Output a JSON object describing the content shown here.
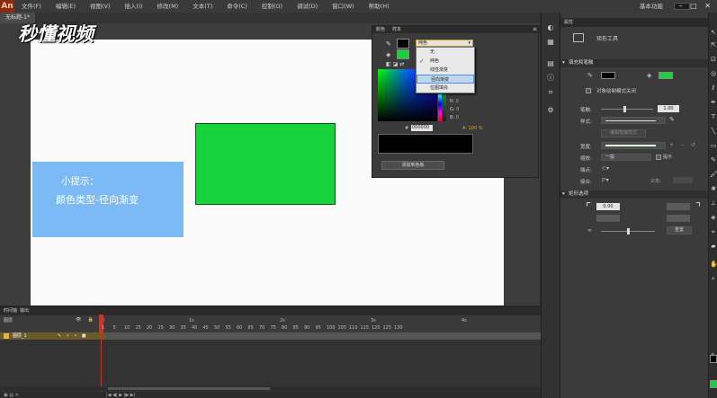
{
  "app": {
    "logo": "An",
    "menus": [
      "文件(F)",
      "编辑(E)",
      "视图(V)",
      "插入(I)",
      "修改(M)",
      "文本(T)",
      "命令(C)",
      "控制(O)",
      "调试(D)",
      "窗口(W)",
      "帮助(H)"
    ],
    "workspace": "基本功能",
    "window_controls": "– □ ✕"
  },
  "document": {
    "tab_title": "无标题-1*",
    "watermark": "秒懂视频"
  },
  "stage": {
    "tip_title": "小提示：",
    "tip_body": "颜色类型-径向渐变",
    "shape_color": "#17d33b",
    "stage_color": "#fbfbfc"
  },
  "color_panel": {
    "tabs": [
      "颜色",
      "样本"
    ],
    "menu_icon": "≡",
    "stroke_color": "#000000",
    "fill_color": "#17d33b",
    "type_select": "纯色",
    "type_options": [
      {
        "label": "无",
        "checked": false
      },
      {
        "label": "纯色",
        "checked": true
      },
      {
        "label": "线性渐变",
        "checked": false
      },
      {
        "label": "径向渐变",
        "checked": false,
        "highlighted": true
      },
      {
        "label": "位图填充",
        "checked": false
      }
    ],
    "hsb": [
      {
        "key": "H",
        "value": "1"
      },
      {
        "key": "S",
        "value": "0"
      },
      {
        "key": "B",
        "value": "0"
      },
      {
        "key": "R",
        "value": "0"
      },
      {
        "key": "G",
        "value": "0"
      },
      {
        "key": "B",
        "value": "0"
      }
    ],
    "hex_label": "#",
    "hex_value": "000000",
    "alpha_label": "A:",
    "alpha_value": "100 %",
    "add_swatch": "添加到色板"
  },
  "properties": {
    "tab_label": "属性",
    "tool_name": "矩形工具",
    "fill_stroke_header": "填充和笔触",
    "object_draw_label": "对象绘制模式关闭",
    "stroke_label": "笔触:",
    "stroke_value": "1.00",
    "style_label": "样式:",
    "edit_style": "编辑笔触样式",
    "width_label": "宽度:",
    "scale_label": "缩放:",
    "scale_value": "一般",
    "hint_label": "提示",
    "cap_label": "端点:",
    "join_label": "接合:",
    "miter_label": "尖角:",
    "rect_options_header": "矩形选项",
    "corner_value": "0.00",
    "reset_label": "重置"
  },
  "timeline": {
    "tabs": [
      "时间轴",
      "输出"
    ],
    "layer_col_label": "图层",
    "layer_name": "图层_1",
    "frame_numbers": [
      "1",
      "5",
      "10",
      "15",
      "20",
      "25",
      "30",
      "35",
      "40",
      "45",
      "50",
      "55",
      "60",
      "65",
      "70",
      "75",
      "80",
      "85",
      "90",
      "95",
      "100",
      "105",
      "110",
      "115",
      "120",
      "125",
      "130"
    ],
    "second_marks": [
      "1s",
      "2s",
      "3s",
      "4s"
    ]
  }
}
